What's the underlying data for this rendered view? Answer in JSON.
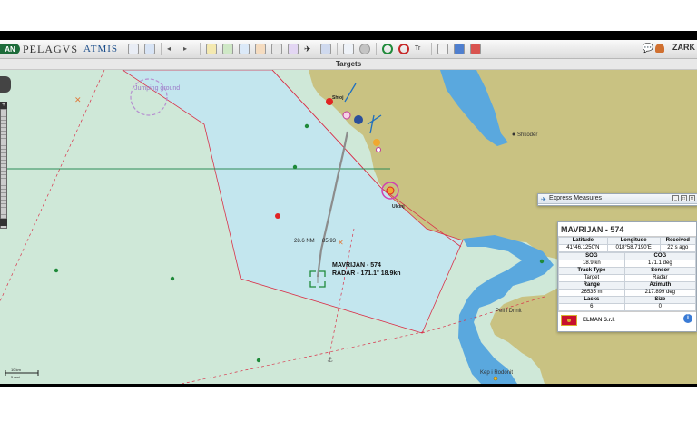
{
  "app": {
    "brand_badge": "AN",
    "brand_name": "PELAGVS",
    "brand_sub": "ATMIS",
    "user_name": "ZARK"
  },
  "subbar": {
    "title": "Targets"
  },
  "map": {
    "labels": {
      "jumping_ground": "Jumping ground",
      "shkoder": "Shkodër",
      "place_ulcinj": "Ulcinj",
      "place_top": "Shtoj",
      "pell_i_drinit": "Pell i Drinit",
      "kep_i_rodonit": "Kep i Rodonit",
      "bearing_distance": "28.6 NM",
      "bearing_deg": "85.93",
      "target_label_1": "MAVRIJAN - 574",
      "target_label_2": "RADAR - 171.1° 18.9kn"
    },
    "scale": {
      "line1": "10 km",
      "line2": "5 nmi"
    },
    "colors": {
      "sea": "#cfe8d8",
      "zone": "#c3e6ee",
      "land": "#c9c282",
      "deep_water": "#5aa8de",
      "zone_border": "#d9334a",
      "track": "#8c8c8c"
    }
  },
  "express_measures": {
    "title": "Express Measures"
  },
  "target_panel": {
    "title": "MAVRIJAN - 574",
    "rows": [
      {
        "headers": [
          "Latitude",
          "Longitude",
          "Received"
        ],
        "values": [
          "41°46.1250'N",
          "018°58.7190'E",
          "22 s ago"
        ]
      },
      {
        "headers": [
          "SOG",
          "COG"
        ],
        "values": [
          "18.9 kn",
          "171.1 deg"
        ]
      },
      {
        "headers": [
          "Track Type",
          "Sensor"
        ],
        "values": [
          "Target",
          "Radar"
        ]
      },
      {
        "headers": [
          "Range",
          "Azimuth"
        ],
        "values": [
          "26535 m",
          "217.899 deg"
        ]
      },
      {
        "headers": [
          "Lacks",
          "Size"
        ],
        "values": [
          "6",
          "0"
        ]
      }
    ],
    "owner": "ELMAN S.r.l.",
    "info": "i"
  }
}
